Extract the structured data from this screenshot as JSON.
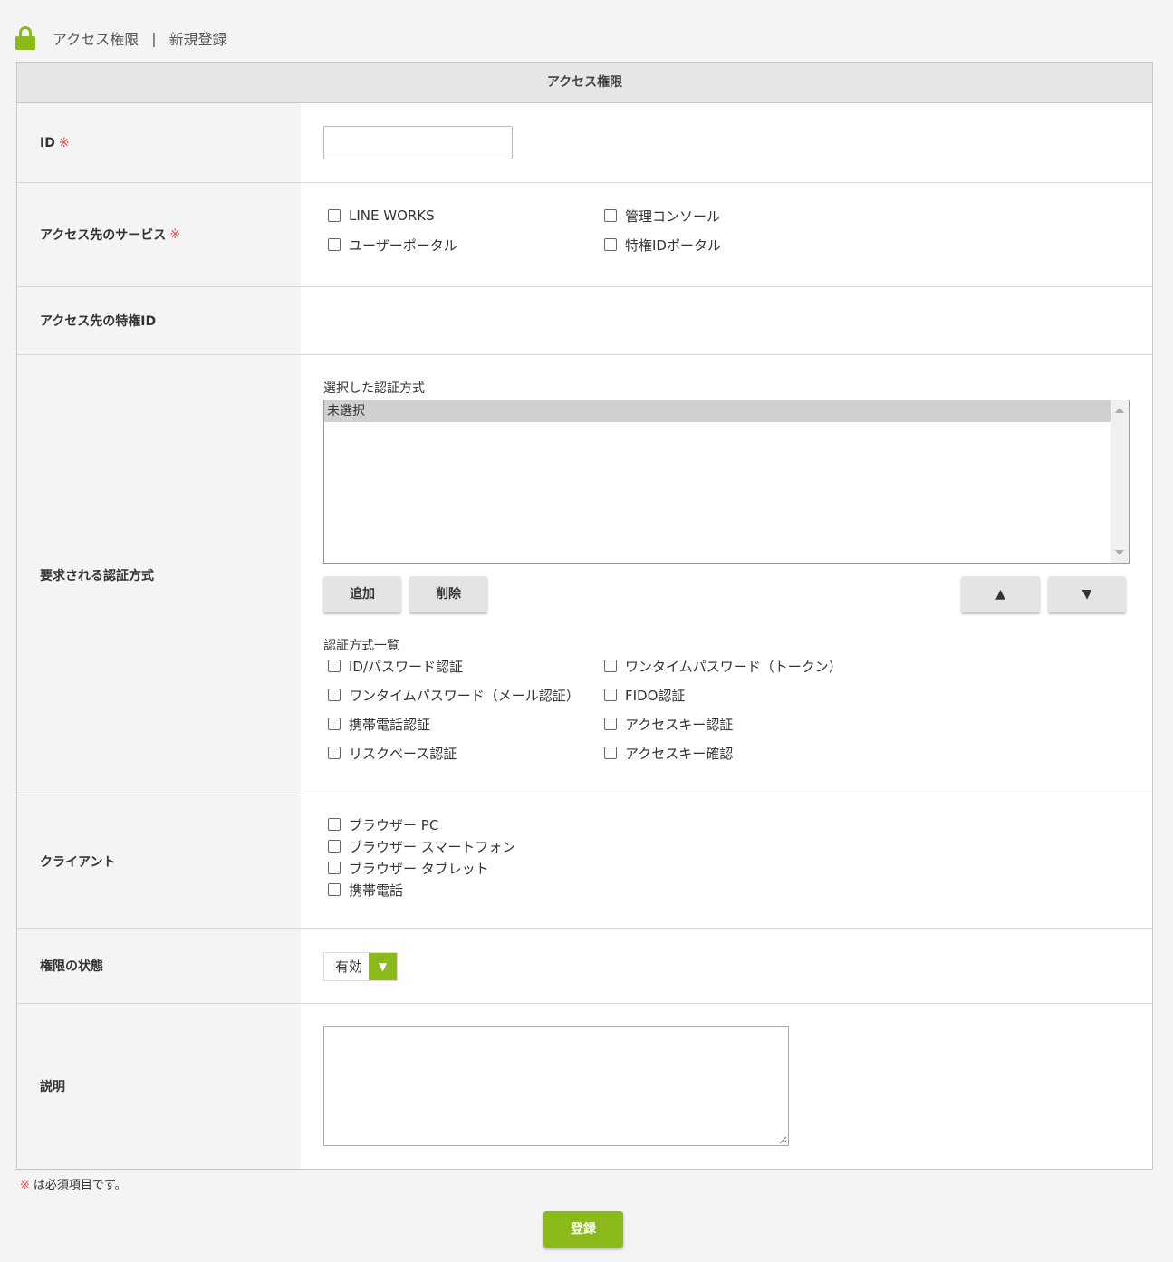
{
  "header": {
    "section": "アクセス権限",
    "separator": "|",
    "page": "新規登録"
  },
  "form": {
    "title": "アクセス権限",
    "required_mark": "※",
    "id": {
      "label": "ID",
      "value": ""
    },
    "service": {
      "label": "アクセス先のサービス",
      "options": [
        "LINE WORKS",
        "管理コンソール",
        "ユーザーポータル",
        "特権IDポータル"
      ]
    },
    "privileged_id": {
      "label": "アクセス先の特権ID"
    },
    "auth": {
      "label": "要求される認証方式",
      "selected_label": "選択した認証方式",
      "selected_items": [
        "未選択"
      ],
      "add": "追加",
      "remove": "削除",
      "up": "▲",
      "down": "▼",
      "list_label": "認証方式一覧",
      "options": [
        "ID/パスワード認証",
        "ワンタイムパスワード（トークン）",
        "ワンタイムパスワード（メール認証）",
        "FIDO認証",
        "携帯電話認証",
        "アクセスキー認証",
        "リスクベース認証",
        "アクセスキー確認"
      ]
    },
    "client": {
      "label": "クライアント",
      "options": [
        "ブラウザー PC",
        "ブラウザー スマートフォン",
        "ブラウザー タブレット",
        "携帯電話"
      ]
    },
    "status": {
      "label": "権限の状態",
      "value": "有効",
      "arrow": "▼"
    },
    "description": {
      "label": "説明",
      "value": ""
    }
  },
  "footnote": {
    "mark": "※",
    "text": "は必須項目です。"
  },
  "submit": "登録",
  "colors": {
    "accent": "#8cba1b",
    "required": "#e05050"
  }
}
